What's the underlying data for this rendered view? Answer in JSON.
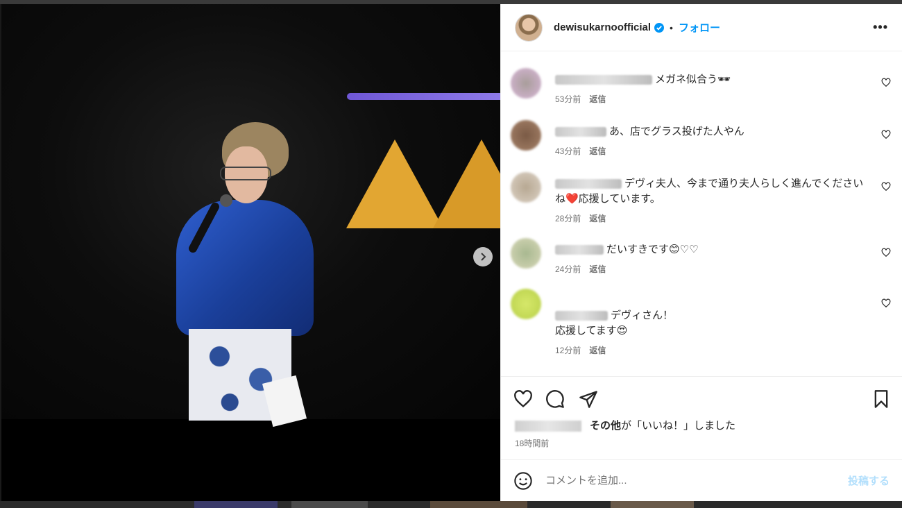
{
  "post": {
    "username": "dewisukarnoofficial",
    "follow_label": "フォロー",
    "dot": "•",
    "more_label": "•••"
  },
  "comments": [
    {
      "text": "メガネ似合う🕶",
      "time": "53分前",
      "reply": "返信"
    },
    {
      "text": "あ、店でグラス投げた人やん",
      "time": "43分前",
      "reply": "返信"
    },
    {
      "text": "デヴィ夫人、今まで通り夫人らしく進んでください ね❤️応援しています。",
      "time": "28分前",
      "reply": "返信"
    },
    {
      "text": "だいすきです😊♡♡",
      "time": "24分前",
      "reply": "返信"
    },
    {
      "text": "デヴィさん！\n応援してます😍",
      "time": "12分前",
      "reply": "返信"
    }
  ],
  "likes": {
    "others_label": "その他",
    "suffix": "が「いいね！」しました",
    "time": "18時間前"
  },
  "comment_box": {
    "placeholder": "コメントを追加...",
    "post_label": "投稿する"
  },
  "colors": {
    "accent": "#0095f6",
    "post_disabled": "#b2dffc",
    "text": "#262626",
    "muted": "#737373"
  }
}
